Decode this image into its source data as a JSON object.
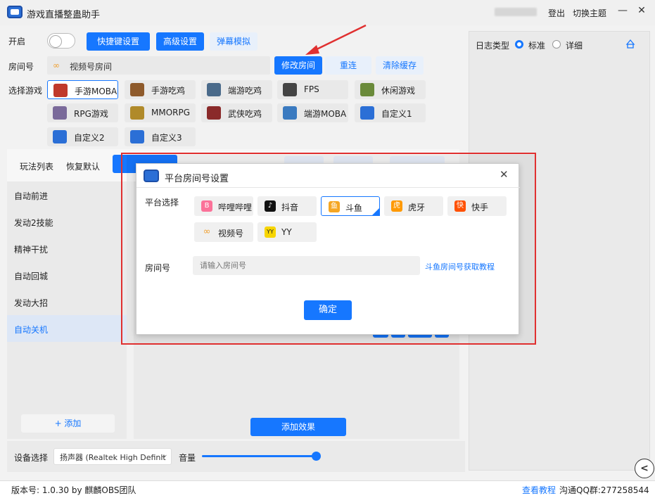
{
  "app": {
    "title": "游戏直播整蛊助手",
    "logout": "登出",
    "switch_theme": "切换主题",
    "minimize": "—",
    "close": "✕"
  },
  "controls": {
    "enable_label": "开启",
    "hotkey_btn": "快捷键设置",
    "advanced_btn": "高级设置",
    "danmaku_btn": "弹幕模拟",
    "room_label": "房间号",
    "room_value": "视频号房间",
    "modify_room_btn": "修改房间",
    "reconnect_btn": "重连",
    "clear_cache_btn": "清除缓存",
    "select_game_label": "选择游戏"
  },
  "games": [
    {
      "label": "手游MOBA",
      "color": "#c0392b"
    },
    {
      "label": "手游吃鸡",
      "color": "#8e5a2b"
    },
    {
      "label": "端游吃鸡",
      "color": "#4a6a8a"
    },
    {
      "label": "FPS",
      "color": "#444"
    },
    {
      "label": "休闲游戏",
      "color": "#6a8a3a"
    },
    {
      "label": "RPG游戏",
      "color": "#7a6a9a"
    },
    {
      "label": "MMORPG",
      "color": "#b08a2a"
    },
    {
      "label": "武侠吃鸡",
      "color": "#8a2a2a"
    },
    {
      "label": "端游MOBA",
      "color": "#3a7ac0"
    },
    {
      "label": "自定义1",
      "color": "#2b6fd6"
    },
    {
      "label": "自定义2",
      "color": "#2b6fd6"
    },
    {
      "label": "自定义3",
      "color": "#2b6fd6"
    }
  ],
  "tabs": {
    "play_list": "玩法列表",
    "restore_default": "恢复默认"
  },
  "side_items": [
    "自动前进",
    "发动2技能",
    "精神干扰",
    "自动回城",
    "发动大招",
    "自动关机"
  ],
  "add_link": "+ 添加",
  "add_effect_btn": "添加效果",
  "device": {
    "label": "设备选择",
    "value": "扬声器 (Realtek High Definit",
    "volume_label": "音量",
    "volume_fraction": 1.0
  },
  "log": {
    "label": "日志类型",
    "standard": "标准",
    "detail": "详细"
  },
  "dialog": {
    "title": "平台房间号设置",
    "platform_label": "平台选择",
    "platforms": [
      {
        "label": "哔哩哔哩",
        "color": "#fb7299",
        "glyph": "B"
      },
      {
        "label": "抖音",
        "color": "#111111",
        "glyph": "♪"
      },
      {
        "label": "斗鱼",
        "color": "#f5a623",
        "glyph": "鱼"
      },
      {
        "label": "虎牙",
        "color": "#ff9900",
        "glyph": "虎"
      },
      {
        "label": "快手",
        "color": "#ff5000",
        "glyph": "快"
      },
      {
        "label": "视频号",
        "color": "#f0a030",
        "glyph": "∞"
      },
      {
        "label": "YY",
        "color": "#f7d500",
        "glyph": "YY"
      }
    ],
    "room_label": "房间号",
    "room_placeholder": "请输入房间号",
    "help_link": "斗鱼房间号获取教程",
    "confirm_btn": "确定"
  },
  "status": {
    "version": "版本号: 1.0.30 by 麒麟OBS团队",
    "tutorial": "查看教程",
    "qq": "沟通QQ群:277258544"
  }
}
